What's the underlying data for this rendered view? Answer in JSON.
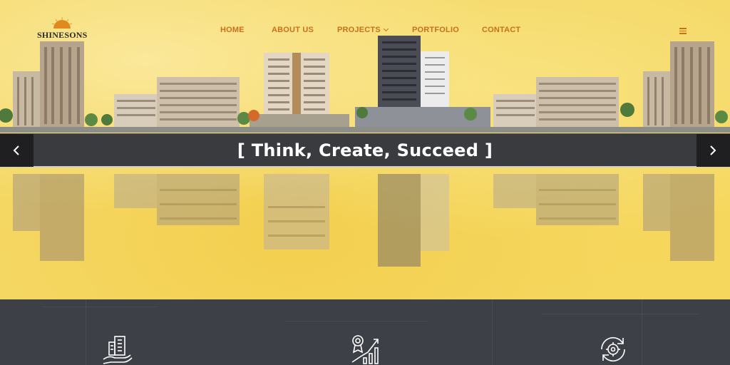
{
  "brand": {
    "name": "SHINESONS"
  },
  "nav": {
    "items": [
      {
        "label": "HOME"
      },
      {
        "label": "ABOUT US"
      },
      {
        "label": "PROJECTS"
      },
      {
        "label": "PORTFOLIO"
      },
      {
        "label": "CONTACT"
      }
    ]
  },
  "hero": {
    "slogan": "[ Think, Create, Succeed ]"
  },
  "colors": {
    "accent": "#c8701a",
    "banner": "#3a3b3f",
    "hero_yellow": "#f4d865",
    "footer": "#3d4046"
  },
  "icons": {
    "features": [
      "building-hand-icon",
      "award-growth-chart-icon",
      "gear-cycle-icon"
    ]
  }
}
